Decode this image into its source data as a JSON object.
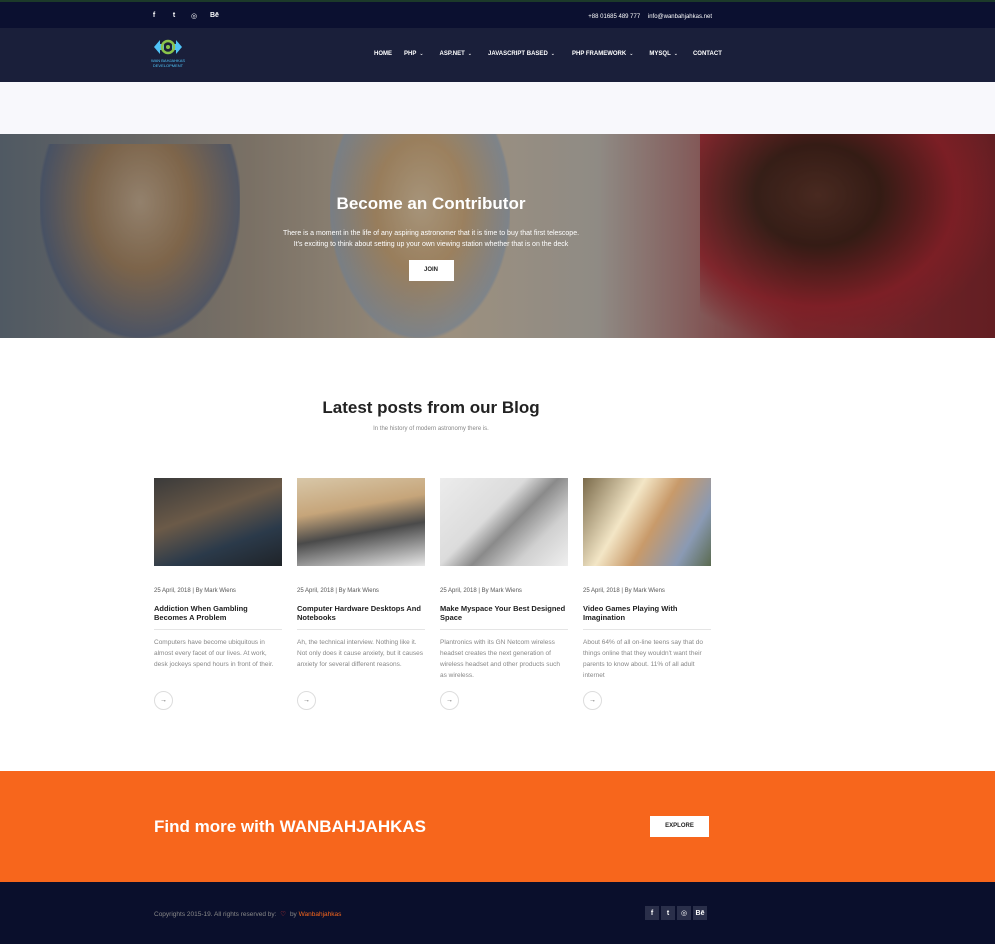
{
  "topbar": {
    "social": [
      "f",
      "t",
      "◎",
      "Bē"
    ],
    "phone": "+88 01685 489 777",
    "email": "info@wanbahjahkas.net"
  },
  "nav": {
    "logo_text": "WAN BAHJAHKAS DEVELOPMENT",
    "items": [
      {
        "label": "HOME",
        "has_dropdown": false
      },
      {
        "label": "PHP",
        "has_dropdown": true
      },
      {
        "label": "ASP.NET",
        "has_dropdown": true
      },
      {
        "label": "JAVASCRIPT BASED",
        "has_dropdown": true
      },
      {
        "label": "PHP FRAMEWORK",
        "has_dropdown": true
      },
      {
        "label": "MYSQL",
        "has_dropdown": true
      },
      {
        "label": "CONTACT",
        "has_dropdown": false
      }
    ]
  },
  "hero": {
    "title": "Become an Contributor",
    "line1": "There is a moment in the life of any aspiring astronomer that it is time to buy that first telescope.",
    "line2": "It's exciting to think about setting up your own viewing station whether that is on the deck",
    "button": "JOIN"
  },
  "blog": {
    "title": "Latest posts from our Blog",
    "subtitle": "In the history of modern astronomy there is.",
    "posts": [
      {
        "meta": "25 April, 2018 | By Mark Wiens",
        "title": "Addiction When Gambling Becomes A Problem",
        "excerpt": "Computers have become ubiquitous in almost every facet of our lives. At work, desk jockeys spend hours in front of their.",
        "arrow": "→"
      },
      {
        "meta": "25 April, 2018 | By Mark Wiens",
        "title": "Computer Hardware Desktops And Notebooks",
        "excerpt": "Ah, the technical interview. Nothing like it. Not only does it cause anxiety, but it causes anxiety for several different reasons.",
        "arrow": "→"
      },
      {
        "meta": "25 April, 2018 | By Mark Wiens",
        "title": "Make Myspace Your Best Designed Space",
        "excerpt": "Plantronics with its GN Netcom wireless headset creates the next generation of wireless headset and other products such as wireless.",
        "arrow": "→"
      },
      {
        "meta": "25 April, 2018 | By Mark Wiens",
        "title": "Video Games Playing With Imagination",
        "excerpt": "About 64% of all on-line teens say that do things online that they wouldn't want their parents to know about. 11% of all adult internet",
        "arrow": "→"
      }
    ]
  },
  "cta": {
    "title": "Find more with WANBAHJAHKAS",
    "button": "EXPLORE"
  },
  "footer": {
    "copyright_prefix": "Copyrights 2015-19. All rights reserved by:",
    "heart": "♡",
    "by": "by",
    "brand": "Wanbahjahkas",
    "social": [
      "f",
      "t",
      "◎",
      "Bē"
    ]
  },
  "colors": {
    "topbar": "#0b1030",
    "navbar": "#1a1f3a",
    "accent": "#f7661c",
    "footer": "#0a0f2c"
  }
}
